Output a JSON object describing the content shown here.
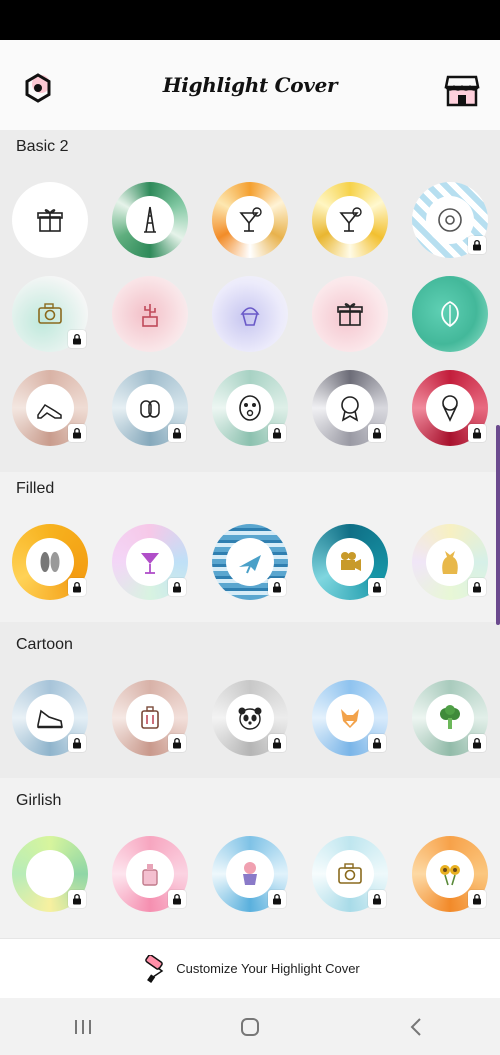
{
  "header": {
    "title": "Highlight Cover",
    "settings_icon": "hexagon-gear-icon",
    "store_icon": "store-icon"
  },
  "sections": [
    {
      "title": "Basic 2",
      "rows": [
        [
          {
            "icon": "gift",
            "style": "floral-red",
            "locked": false
          },
          {
            "icon": "eiffel-tower",
            "style": "leaves-green",
            "locked": false
          },
          {
            "icon": "cocktail",
            "style": "citrus-orange",
            "locked": false
          },
          {
            "icon": "cocktail",
            "style": "lemon-yellow",
            "locked": false
          },
          {
            "icon": "donut",
            "style": "chevron-blue",
            "locked": true
          }
        ],
        [
          {
            "icon": "camera",
            "style": "watercolor-mint",
            "locked": true
          },
          {
            "icon": "cactus",
            "style": "watercolor-pink",
            "locked": false
          },
          {
            "icon": "cupcake",
            "style": "watercolor-lavender",
            "locked": false
          },
          {
            "icon": "gift",
            "style": "watercolor-rose",
            "locked": false
          },
          {
            "icon": "monstera-leaf",
            "style": "watercolor-teal",
            "locked": false
          }
        ],
        [
          {
            "icon": "heels",
            "style": "glitter-rose",
            "locked": true
          },
          {
            "icon": "mittens",
            "style": "glitter-blue",
            "locked": true
          },
          {
            "icon": "face-mask",
            "style": "glitter-mint",
            "locked": true
          },
          {
            "icon": "award-ribbon",
            "style": "metal-silver",
            "locked": true
          },
          {
            "icon": "ice-cream",
            "style": "glitter-red",
            "locked": true
          }
        ]
      ]
    },
    {
      "title": "Filled",
      "rows": [
        [
          {
            "icon": "flip-flops",
            "style": "fill-orange",
            "locked": true
          },
          {
            "icon": "cocktail-glass",
            "style": "fill-pastel",
            "locked": true
          },
          {
            "icon": "airplane",
            "style": "fill-stripes-blue",
            "locked": true
          },
          {
            "icon": "movie-camera",
            "style": "fill-teal",
            "locked": true
          },
          {
            "icon": "cat",
            "style": "fill-rainbow",
            "locked": true
          }
        ]
      ]
    },
    {
      "title": "Cartoon",
      "rows": [
        [
          {
            "icon": "sneaker",
            "style": "ring-blue",
            "locked": true
          },
          {
            "icon": "suitcase",
            "style": "ring-rose",
            "locked": true
          },
          {
            "icon": "panda",
            "style": "ring-grey",
            "locked": true
          },
          {
            "icon": "fox",
            "style": "ring-sky",
            "locked": true
          },
          {
            "icon": "broccoli",
            "style": "ring-sage",
            "locked": true
          }
        ]
      ]
    },
    {
      "title": "Girlish",
      "rows": [
        [
          {
            "icon": "monstera-leaf",
            "style": "gradient-green",
            "locked": true
          },
          {
            "icon": "perfume",
            "style": "gradient-pink",
            "locked": true
          },
          {
            "icon": "flower-pot",
            "style": "gradient-paint-blue",
            "locked": true
          },
          {
            "icon": "camera",
            "style": "gradient-paint-teal",
            "locked": true
          },
          {
            "icon": "sunflowers",
            "style": "gradient-orange",
            "locked": true
          }
        ]
      ]
    }
  ],
  "banner": {
    "icon": "paint-roller-icon",
    "label": "Customize Your Highlight Cover"
  },
  "navbar": {
    "recents_icon": "recents-icon",
    "home_icon": "home-icon",
    "back_icon": "back-icon"
  },
  "colors": {
    "accent_pink": "#ff4f8b",
    "background": "#ececec"
  }
}
